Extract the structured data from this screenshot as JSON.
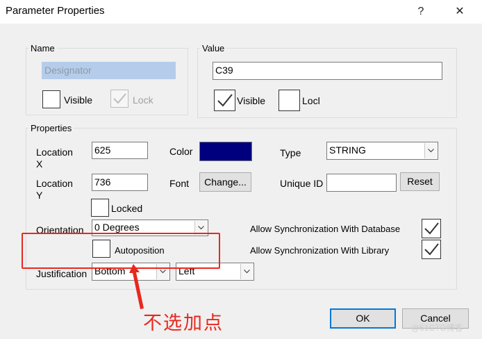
{
  "window": {
    "title": "Parameter Properties",
    "help_glyph": "?",
    "close_glyph": "✕"
  },
  "name_group": {
    "title": "Name",
    "name_value": "Designator",
    "visible_label": "Visible",
    "visible_checked": false,
    "lock_label": "Lock",
    "lock_checked": true
  },
  "value_group": {
    "title": "Value",
    "value": "C39",
    "visible_label": "Visible",
    "visible_checked": true,
    "lock_label": "Locl",
    "lock_checked": false
  },
  "properties": {
    "title": "Properties",
    "location_x_label": "Location\nX",
    "location_x_label_l1": "Location",
    "location_x_label_l2": "X",
    "location_x": "625",
    "location_y_label_l1": "Location",
    "location_y_label_l2": "Y",
    "location_y": "736",
    "color_label": "Color",
    "color_value": "#00007f",
    "font_label": "Font",
    "change_button": "Change...",
    "type_label": "Type",
    "type_value": "STRING",
    "unique_id_label": "Unique ID",
    "unique_id_value": "",
    "reset_button": "Reset",
    "locked_label": "Locked",
    "locked_checked": false,
    "orientation_label": "Orientation",
    "orientation_value": "0 Degrees",
    "autoposition_label": "Autoposition",
    "autoposition_checked": false,
    "justification_label": "Justification",
    "justification_vertical": "Bottom",
    "justification_horizontal": "Left",
    "sync_database_label": "Allow Synchronization With Database",
    "sync_database_checked": true,
    "sync_library_label": "Allow Synchronization With Library",
    "sync_library_checked": true
  },
  "buttons": {
    "ok": "OK",
    "cancel": "Cancel"
  },
  "annotation": {
    "text": "不选加点",
    "color": "#e8281e"
  },
  "watermark": "@51CTO博客"
}
